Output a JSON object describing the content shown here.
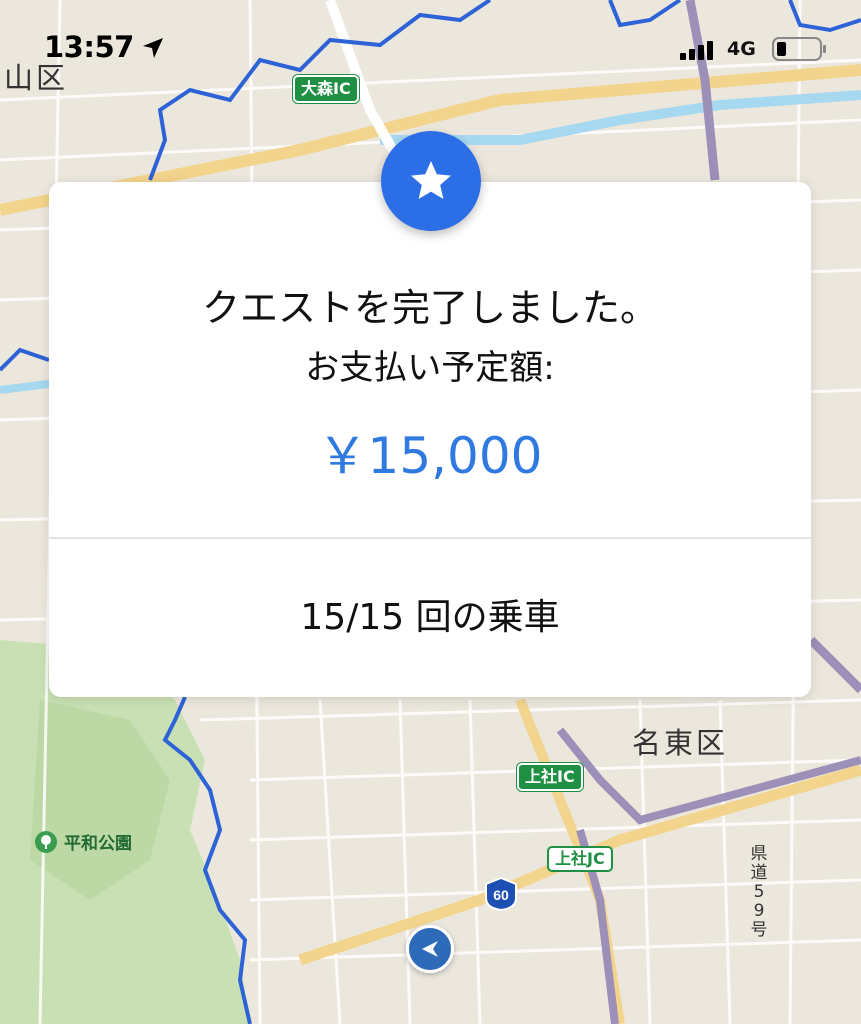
{
  "status_bar": {
    "time": "13:57",
    "network": "4G"
  },
  "map": {
    "district_left": "山区",
    "district_right": "名東区",
    "ic_omori": "大森IC",
    "ic_kamiyashiro": "上社IC",
    "jc_kamiyashiro": "上社JC",
    "park": "平和公園",
    "prefectural_road": "県道59号",
    "route_number": "60"
  },
  "card": {
    "title": "クエストを完了しました。",
    "subtitle": "お支払い予定額:",
    "amount": "￥15,000",
    "rides": "15/15 回の乗車"
  },
  "colors": {
    "accent": "#2f7ae0",
    "badge": "#2c6ee6",
    "boundary": "#2d63d6"
  }
}
